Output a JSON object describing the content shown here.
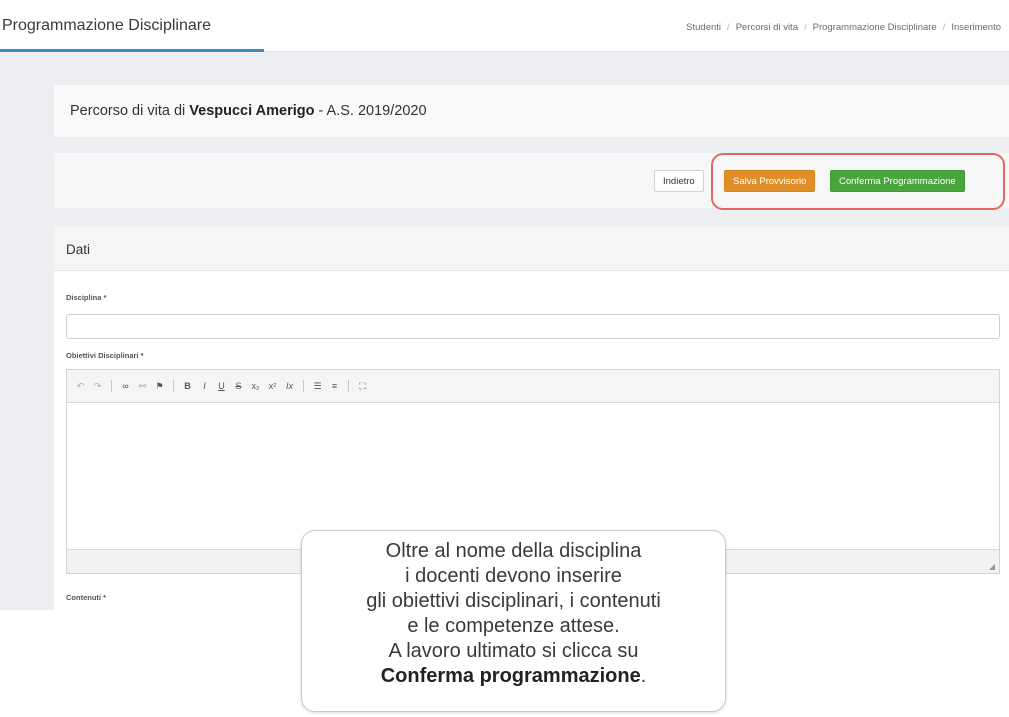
{
  "header": {
    "title": "Programmazione Disciplinare",
    "breadcrumb": [
      "Studenti",
      "Percorsi di vita",
      "Programmazione Disciplinare",
      "Inserimento"
    ]
  },
  "student_card": {
    "prefix": "Percorso di vita di ",
    "student_name": "Vespucci Amerigo",
    "suffix": " - A.S. 2019/2020"
  },
  "actions": {
    "back_label": "Indietro",
    "draft_label": "Salva Provvisorio",
    "confirm_label": "Conferma Programmazione"
  },
  "form": {
    "section_title": "Dati",
    "fields": {
      "disciplina_label": "Disciplina *",
      "disciplina_value": "",
      "obiettivi_label": "Obiettivi Disciplinari *",
      "contenuti_label": "Contenuti *"
    },
    "toolbar_icons": [
      "undo-icon",
      "redo-icon",
      "link-icon",
      "unlink-icon",
      "flag-icon",
      "bold-icon",
      "italic-icon",
      "underline-icon",
      "strikethrough-icon",
      "subscript-icon",
      "superscript-icon",
      "clear-format-icon",
      "numbered-list-icon",
      "bullet-list-icon",
      "maximize-icon"
    ]
  },
  "callout": {
    "lines": [
      "Oltre al nome della disciplina",
      "i docenti devono inserire",
      "gli obiettivi disciplinari, i contenuti",
      "e le competenze attese.",
      "A lavoro ultimato si clicca su"
    ],
    "bold_text": "Conferma programmazione",
    "end_punct": "."
  },
  "colors": {
    "accent": "#3c8dbc",
    "draft_button": "#e08e2a",
    "confirm_button": "#4aa53f",
    "highlight_ring": "#e2685f"
  }
}
